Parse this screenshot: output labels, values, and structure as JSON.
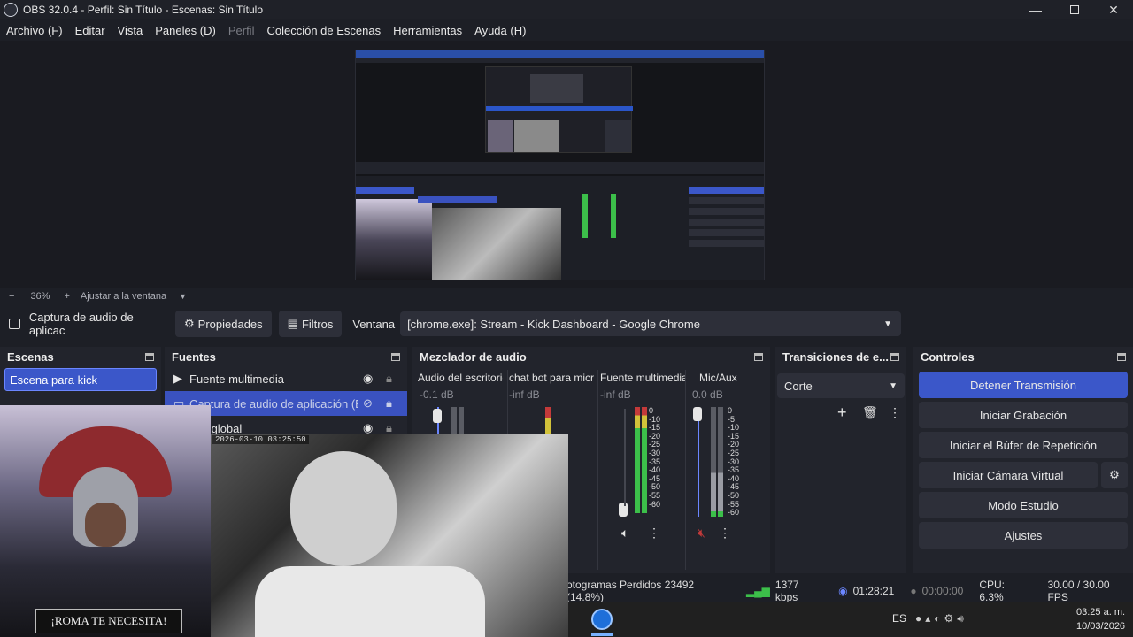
{
  "window": {
    "title": "OBS 32.0.4 - Perfil: Sin Título - Escenas: Sin Título",
    "minimize_icon": "minimize-icon",
    "maximize_icon": "restore-icon",
    "close_icon": "close-icon"
  },
  "menu": {
    "items": [
      "Archivo (F)",
      "Editar",
      "Vista",
      "Paneles (D)",
      "Perfil",
      "Colección de Escenas",
      "Herramientas",
      "Ayuda (H)"
    ],
    "disabled_index": 4
  },
  "zoom": {
    "minus": "−",
    "value": "36%",
    "plus": "+",
    "fit": "Ajustar a la ventana"
  },
  "source_toolbar": {
    "source_name": "Captura de audio de aplicac",
    "properties": "Propiedades",
    "filters": "Filtros",
    "window_label": "Ventana",
    "window_value": "[chrome.exe]: Stream - Kick Dashboard - Google Chrome"
  },
  "scenes": {
    "title": "Escenas",
    "items": [
      "Escena para kick"
    ]
  },
  "sources": {
    "title": "Fuentes",
    "items": [
      {
        "label": "Fuente multimedia",
        "icon": "play-icon"
      },
      {
        "label": "Captura de audio de aplicación (BE",
        "icon": "speaker-icon",
        "selected": true
      },
      {
        "label": "zen global",
        "icon": "image-icon"
      }
    ]
  },
  "mixer": {
    "title": "Mezclador de audio",
    "channels": [
      {
        "name": "Audio del escritoric",
        "db": "-0.1 dB"
      },
      {
        "name": "chat bot para micro",
        "db": "-inf dB"
      },
      {
        "name": "Fuente multimedia",
        "db": "-inf dB"
      },
      {
        "name": "Mic/Aux",
        "db": "0.0 dB"
      }
    ],
    "scale": [
      "0",
      "-5",
      "-10",
      "-15",
      "-20",
      "-25",
      "-30",
      "-35",
      "-40",
      "-45",
      "-50",
      "-55",
      "-60"
    ]
  },
  "transitions": {
    "title": "Transiciones de e...",
    "selected": "Corte"
  },
  "controls": {
    "title": "Controles",
    "buttons": [
      "Detener Transmisión",
      "Iniciar Grabación",
      "Iniciar el Búfer de Repetición",
      "Iniciar Cámara Virtual",
      "Modo Estudio",
      "Ajustes"
    ]
  },
  "status": {
    "dropped": "otogramas Perdidos 23492 (14.8%)",
    "bitrate": "1377 kbps",
    "stream_time": "01:28:21",
    "rec_time": "00:00:00",
    "cpu": "CPU: 6.3%",
    "fps": "30.00 / 30.00 FPS"
  },
  "webcam_overlay": {
    "timestamp": "2026-03-10  03:25:50"
  },
  "poster": {
    "caption": "¡ROMA TE NECESITA!"
  },
  "taskbar": {
    "lang": "ES",
    "time": "03:25 a. m.",
    "date": "10/03/2026"
  },
  "colors": {
    "accent": "#3b57c9",
    "meter_green": "#3cbf4a",
    "meter_yellow": "#d2c23a",
    "meter_red": "#c43a3a"
  }
}
